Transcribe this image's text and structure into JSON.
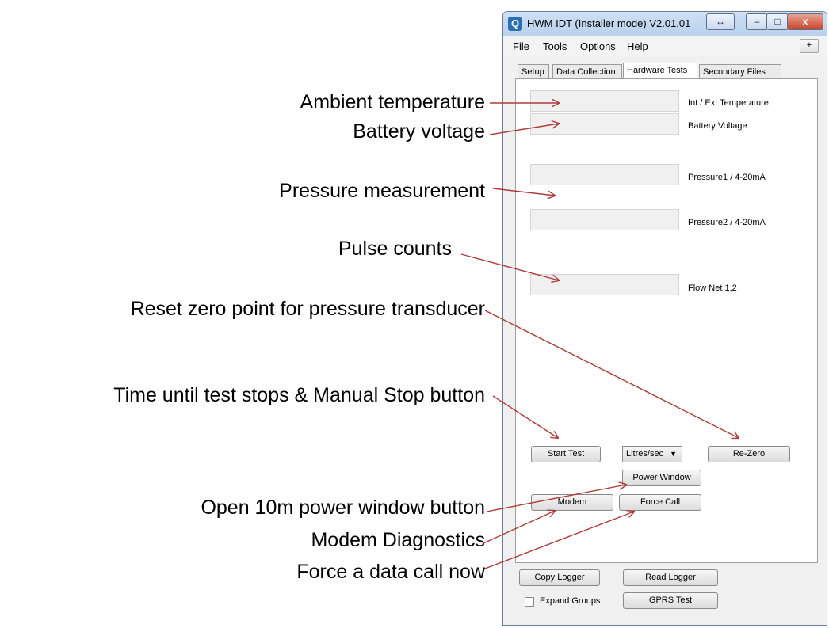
{
  "window": {
    "title": "HWM IDT (Installer mode) V2.01.01",
    "app_icon_glyph": "Q",
    "resize_glyph": "↔",
    "minimize_glyph": "–",
    "maximize_glyph": "□",
    "close_glyph": "x"
  },
  "menu": {
    "items": [
      "File",
      "Tools",
      "Options",
      "Help"
    ],
    "plus_label": "+"
  },
  "tabs": [
    {
      "label": "Setup"
    },
    {
      "label": "Data Collection"
    },
    {
      "label": "Hardware Tests",
      "active": true
    },
    {
      "label": "Secondary Files"
    }
  ],
  "readings": [
    {
      "label": "Int / Ext Temperature"
    },
    {
      "label": "Battery Voltage"
    },
    {
      "label": "Pressure1 / 4-20mA"
    },
    {
      "label": "Pressure2 / 4-20mA"
    },
    {
      "label": "Flow Net 1,2"
    }
  ],
  "controls": {
    "start_test": "Start Test",
    "units_select": "Litres/sec",
    "re_zero": "Re-Zero",
    "power_window": "Power Window",
    "modem": "Modem",
    "force_call": "Force Call"
  },
  "footer": {
    "copy_logger": "Copy Logger",
    "read_logger": "Read Logger",
    "expand_groups": "Expand Groups",
    "gprs_test": "GPRS Test"
  },
  "annotations": [
    "Ambient temperature",
    "Battery voltage",
    "Pressure measurement",
    "Pulse counts",
    "Reset zero point for pressure transducer",
    "Time until test stops & Manual Stop button",
    "Open 10m power window button",
    "Modem Diagnostics",
    "Force a data call now"
  ],
  "colors": {
    "arrow": "#b03a3a",
    "titlebar": "#c4d8f0"
  }
}
